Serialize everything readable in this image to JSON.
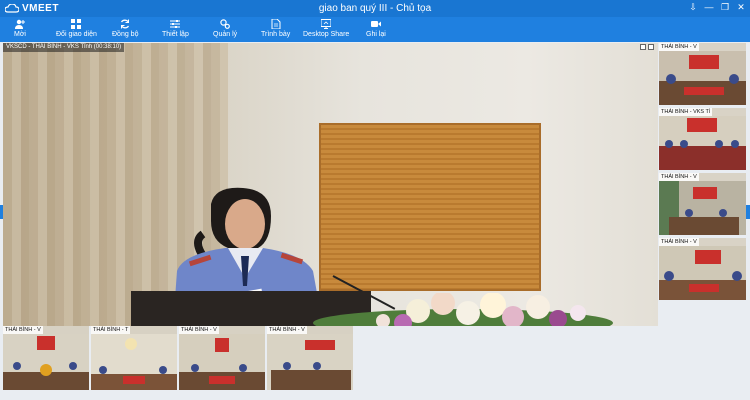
{
  "window": {
    "logo_text": "VMEET",
    "title": "giao ban quý III - Chủ tọa",
    "controls": [
      "⇩",
      "—",
      "❐",
      "✕"
    ]
  },
  "toolbar": {
    "items": [
      {
        "id": "moi",
        "label": "Mời",
        "icon": "user-add-icon"
      },
      {
        "id": "doi-giao-dien",
        "label": "Đổi giao diện",
        "icon": "layout-grid-icon"
      },
      {
        "id": "dong-bo",
        "label": "Đồng bộ",
        "icon": "sync-icon"
      },
      {
        "id": "thiet-lap",
        "label": "Thiết lập",
        "icon": "sliders-icon"
      },
      {
        "id": "quan-ly",
        "label": "Quản lý",
        "icon": "gear-icon"
      },
      {
        "id": "trinh-bay",
        "label": "Trình bày",
        "icon": "present-icon"
      },
      {
        "id": "desktop-share",
        "label": "Desktop Share",
        "icon": "monitor-share-icon"
      },
      {
        "id": "ghi-lai",
        "label": "Ghi lại",
        "icon": "video-record-icon"
      }
    ]
  },
  "main_video": {
    "label": "VKSCD - THÁI BÌNH - VKS Tỉnh (00:38:10)"
  },
  "right_tiles": [
    {
      "label": "THÁI BÌNH - V"
    },
    {
      "label": "THÁI BÌNH - VKS Tỉ"
    },
    {
      "label": "THÁI BÌNH - V"
    },
    {
      "label": "THÁI BÌNH - V"
    }
  ],
  "bottom_tiles": [
    {
      "label": "THÁI BÌNH - V"
    },
    {
      "label": "THÁI BÌNH - T"
    },
    {
      "label": "THÁI BÌNH - V"
    },
    {
      "label": "THÁI BÌNH - V"
    }
  ],
  "colors": {
    "titlebar": "#1976d2",
    "toolbar": "#1f80e0"
  }
}
